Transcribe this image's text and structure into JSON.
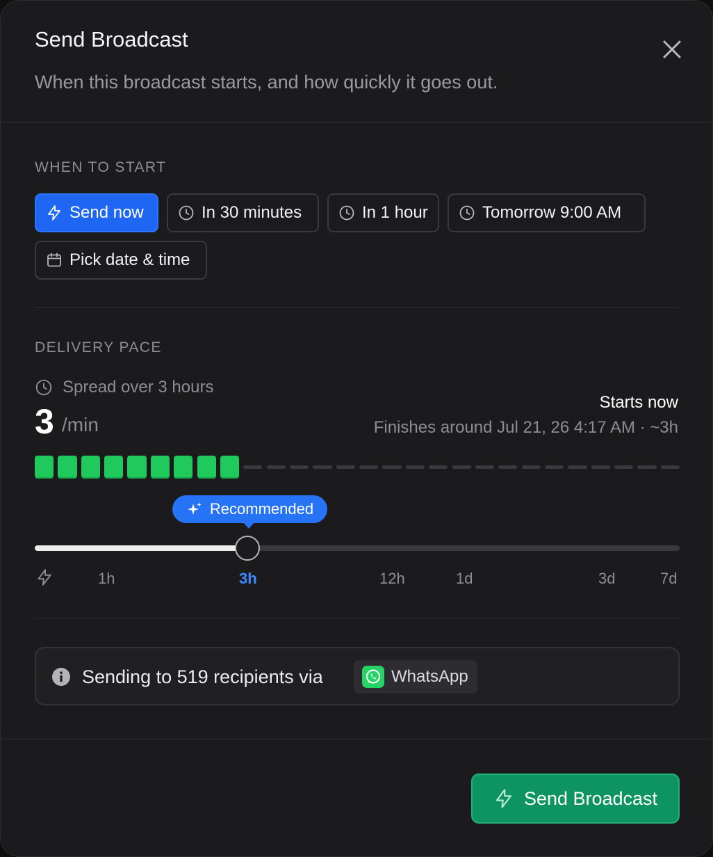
{
  "dialog": {
    "title": "Send Broadcast",
    "subtitle": "When this broadcast starts, and how quickly it goes out."
  },
  "when_to_start": {
    "label": "WHEN TO START",
    "options": [
      {
        "label": "Send now",
        "icon": "lightning-icon",
        "selected": true
      },
      {
        "label": "In 30 minutes",
        "icon": "clock-icon",
        "selected": false
      },
      {
        "label": "In 1 hour",
        "icon": "clock-icon",
        "selected": false
      },
      {
        "label": "Tomorrow 9:00 AM",
        "icon": "clock-icon",
        "selected": false
      },
      {
        "label": "Pick date & time",
        "icon": "calendar-icon",
        "selected": false
      }
    ]
  },
  "delivery_pace": {
    "label": "DELIVERY PACE",
    "spread_label": "Spread over 3 hours",
    "rate_value": "3",
    "rate_unit": "/min",
    "starts": "Starts now",
    "finishes": "Finishes around Jul 21, 26 4:17 AM · ~3h",
    "segments_total": 28,
    "segments_filled": 9,
    "recommended_label": "Recommended",
    "slider_value_fraction": 0.33,
    "ticks": [
      {
        "label": "1h",
        "active": false
      },
      {
        "label": "3h",
        "active": true
      },
      {
        "label": "12h",
        "active": false
      },
      {
        "label": "1d",
        "active": false
      },
      {
        "label": "3d",
        "active": false
      },
      {
        "label": "7d",
        "active": false
      }
    ]
  },
  "info": {
    "text": "Sending to 519 recipients via",
    "channel": "WhatsApp"
  },
  "footer": {
    "send_label": "Send Broadcast"
  },
  "colors": {
    "accent_blue": "#1f66f2",
    "segment_green": "#1fc95c",
    "send_green": "#0e9462",
    "whatsapp_green": "#25d366"
  }
}
